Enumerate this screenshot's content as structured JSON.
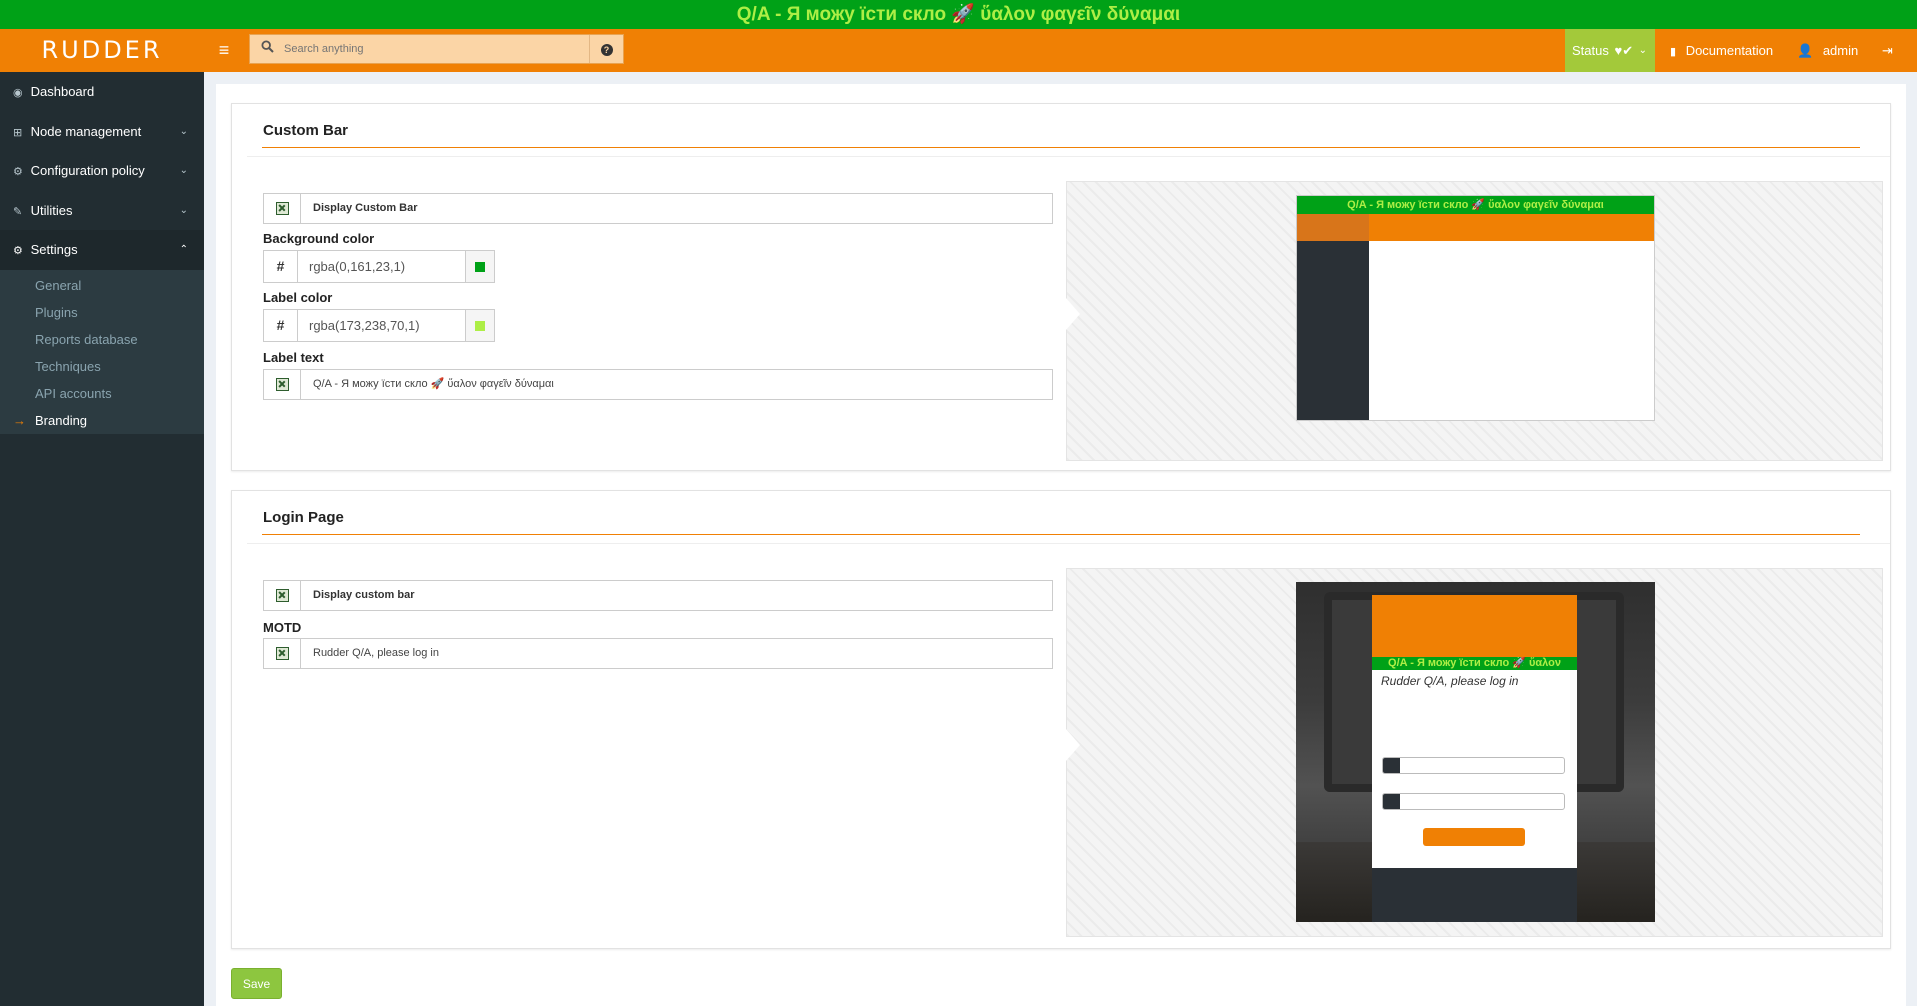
{
  "custom_bar": {
    "label": "Q/A - Я можу їсти скло 🚀 ὕαλον φαγεῖν δύναμαι",
    "bg_color": "#00a117",
    "label_color": "#adee46"
  },
  "header": {
    "logo": "RUDDER",
    "search_placeholder": "Search anything",
    "status_label": "Status",
    "documentation_label": "Documentation",
    "user_label": "admin",
    "accent_color": "#f08004"
  },
  "sidebar": {
    "items": [
      {
        "label": "Dashboard",
        "icon": "dashboard-icon"
      },
      {
        "label": "Node management",
        "icon": "sitemap-icon"
      },
      {
        "label": "Configuration policy",
        "icon": "gears-icon"
      },
      {
        "label": "Utilities",
        "icon": "wrench-icon"
      },
      {
        "label": "Settings",
        "icon": "gear-icon"
      }
    ],
    "settings_sub": [
      "General",
      "Plugins",
      "Reports database",
      "Techniques",
      "API accounts",
      "Branding"
    ]
  },
  "custom_bar_panel": {
    "title": "Custom Bar",
    "display_label": "Display Custom Bar",
    "bg_color_label": "Background color",
    "bg_color_value": "rgba(0,161,23,1)",
    "label_color_label": "Label color",
    "label_color_value": "rgba(173,238,70,1)",
    "label_text_label": "Label text",
    "label_text_value": "Q/A - Я можу їсти скло 🚀 ὕαλον φαγεῖν δύναμαι",
    "preview_bar_text": "Q/A - Я можу їсти скло 🚀 ὕαλον φαγεῖν δύναμαι"
  },
  "login_panel": {
    "title": "Login Page",
    "display_label": "Display custom bar",
    "motd_label": "MOTD",
    "motd_value": "Rudder Q/A, please log in",
    "preview_bar_text": "Q/A - Я можу їсти скло 🚀 ὕαλον",
    "preview_motd": "Rudder Q/A, please log in"
  },
  "save_label": "Save"
}
